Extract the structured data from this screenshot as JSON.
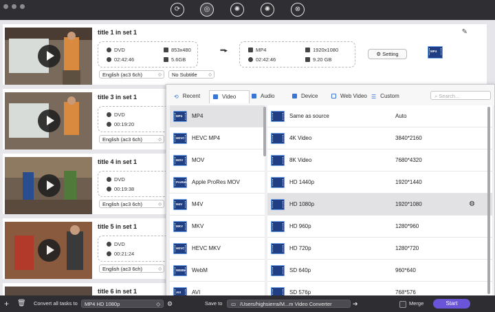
{
  "toolbar": {
    "icons": [
      "convert-icon",
      "rip-icon",
      "video-disc-icon",
      "film-reel-icon",
      "toolbox-icon"
    ],
    "active_index": 1
  },
  "tasks": [
    {
      "title": "title 1 in set 1",
      "source": {
        "format": "DVD",
        "resolution": "853x480",
        "duration": "02:42:46",
        "size": "5.6GB"
      },
      "target": {
        "format": "MP4",
        "resolution": "1920x1080",
        "duration": "02:42:46",
        "size": "9.20 GB"
      },
      "audio": "English (ac3 6ch)",
      "subtitle": "No Subtitle",
      "setting_label": "Setting",
      "format_icon_label": "MP4"
    },
    {
      "title": "title 3 in set 1",
      "source": {
        "format": "DVD",
        "duration": "00:19:20"
      },
      "audio": "English (ac3 6ch)"
    },
    {
      "title": "title 4 in set 1",
      "source": {
        "format": "DVD",
        "duration": "00:19:38"
      },
      "audio": "English (ac3 6ch)"
    },
    {
      "title": "title 5 in set 1",
      "source": {
        "format": "DVD",
        "duration": "00:21:24"
      },
      "audio": "English (ac3 6ch)"
    },
    {
      "title": "title 6 in set 1"
    }
  ],
  "format_panel": {
    "tabs": [
      "Recent",
      "Video",
      "Audio",
      "Device",
      "Web Video",
      "Custom"
    ],
    "active_tab": "Video",
    "search_placeholder": "Search...",
    "formats": [
      {
        "name": "MP4",
        "icon": "MP4"
      },
      {
        "name": "HEVC MP4",
        "icon": "HEVC"
      },
      {
        "name": "MOV",
        "icon": "MOV"
      },
      {
        "name": "Apple ProRes MOV",
        "icon": "ProRes"
      },
      {
        "name": "M4V",
        "icon": "M4V"
      },
      {
        "name": "MKV",
        "icon": "MKV"
      },
      {
        "name": "HEVC MKV",
        "icon": "HEVC"
      },
      {
        "name": "WebM",
        "icon": "WEBM"
      },
      {
        "name": "AVI",
        "icon": "AVI"
      }
    ],
    "presets": [
      {
        "name": "Same as source",
        "resolution": "Auto"
      },
      {
        "name": "4K Video",
        "resolution": "3840*2160"
      },
      {
        "name": "8K Video",
        "resolution": "7680*4320"
      },
      {
        "name": "HD 1440p",
        "resolution": "1920*1440"
      },
      {
        "name": "HD 1080p",
        "resolution": "1920*1080"
      },
      {
        "name": "HD 960p",
        "resolution": "1280*960"
      },
      {
        "name": "HD 720p",
        "resolution": "1280*720"
      },
      {
        "name": "SD 640p",
        "resolution": "960*640"
      },
      {
        "name": "SD 576p",
        "resolution": "768*576"
      }
    ]
  },
  "bottom": {
    "convert_all_label": "Convert all tasks to",
    "convert_all_value": "MP4 HD 1080p",
    "save_to_label": "Save to",
    "save_path": "/Users/highsierra/M...m Video Converter",
    "merge_label": "Merge",
    "start_label": "Start"
  },
  "colors": {
    "accent": "#6a55d8",
    "checkbox": "#3b76e8",
    "titlebar": "#2f2f33"
  }
}
